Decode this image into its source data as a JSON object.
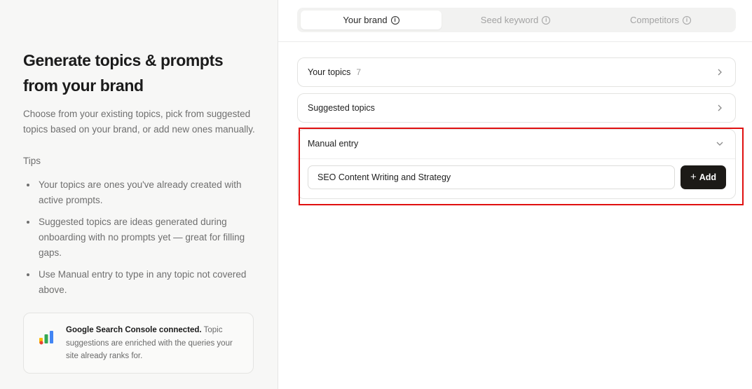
{
  "left": {
    "heading": "Generate topics & prompts from your brand",
    "description": "Choose from your existing topics, pick from suggested topics based on your brand, or add new ones manually.",
    "tips_title": "Tips",
    "tips": [
      "Your topics are ones you've already created with active prompts.",
      "Suggested topics are ideas generated during onboarding with no prompts yet — great for filling gaps.",
      "Use Manual entry to type in any topic not covered above."
    ],
    "gsc": {
      "bold": "Google Search Console connected.",
      "text": " Topic suggestions are enriched with the queries your site already ranks for.",
      "logo_icon": "google-search-console-icon"
    }
  },
  "tabs": [
    {
      "label": "Your brand",
      "active": true
    },
    {
      "label": "Seed keyword",
      "active": false
    },
    {
      "label": "Competitors",
      "active": false
    }
  ],
  "sections": {
    "your_topics": {
      "label": "Your topics",
      "count": "7"
    },
    "suggested_topics": {
      "label": "Suggested topics"
    },
    "manual_entry": {
      "label": "Manual entry",
      "input_value": "SEO Content Writing and Strategy",
      "add_label": "Add"
    }
  },
  "colors": {
    "accent_dark": "#1c1a17",
    "highlight": "#e01010",
    "panel_bg": "#f7f7f6"
  }
}
